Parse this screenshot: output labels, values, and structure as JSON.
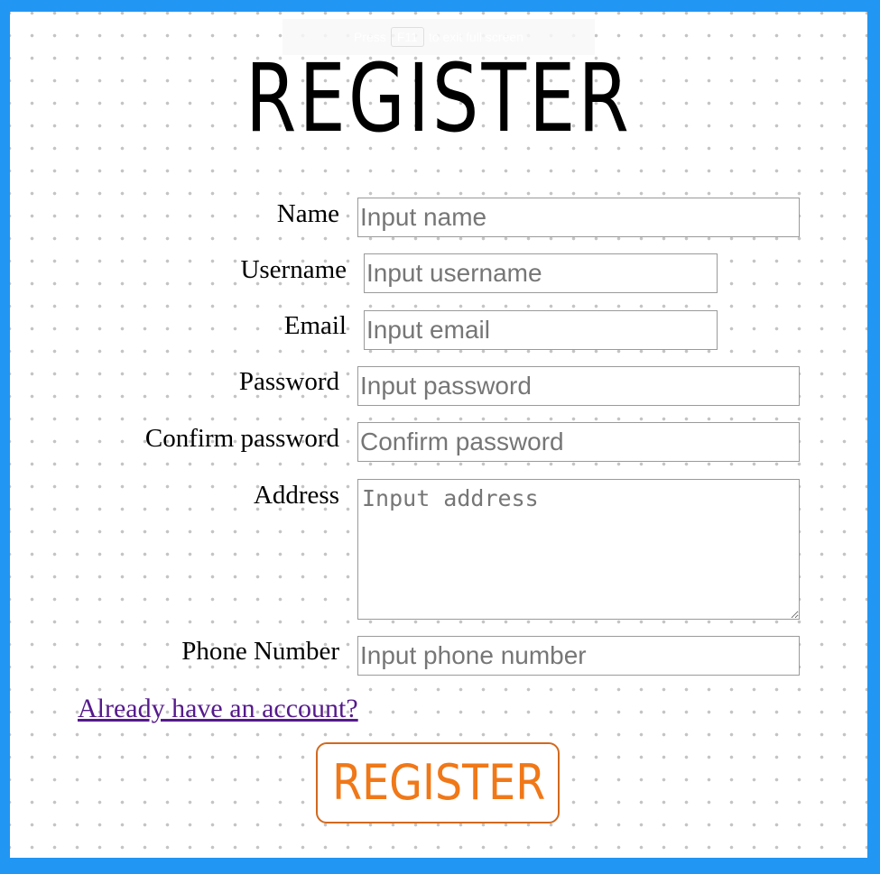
{
  "fullscreen_hint": {
    "prefix": "Press",
    "key": "F11",
    "suffix": "to exit full screen"
  },
  "title": "REGISTER",
  "form": {
    "name": {
      "label": "Name",
      "placeholder": "Input name"
    },
    "username": {
      "label": "Username",
      "placeholder": "Input username"
    },
    "email": {
      "label": "Email",
      "placeholder": "Input email"
    },
    "password": {
      "label": "Password",
      "placeholder": "Input password"
    },
    "confirm_password": {
      "label": "Confirm password",
      "placeholder": "Confirm password"
    },
    "address": {
      "label": "Address",
      "placeholder": "Input address"
    },
    "phone": {
      "label": "Phone Number",
      "placeholder": "Input phone number"
    }
  },
  "login_link": "Already have an account?",
  "register_button": "REGISTER",
  "colors": {
    "border": "#2196f3",
    "link": "#551a8b",
    "button_text": "#f07818",
    "button_border": "#d2691e"
  }
}
